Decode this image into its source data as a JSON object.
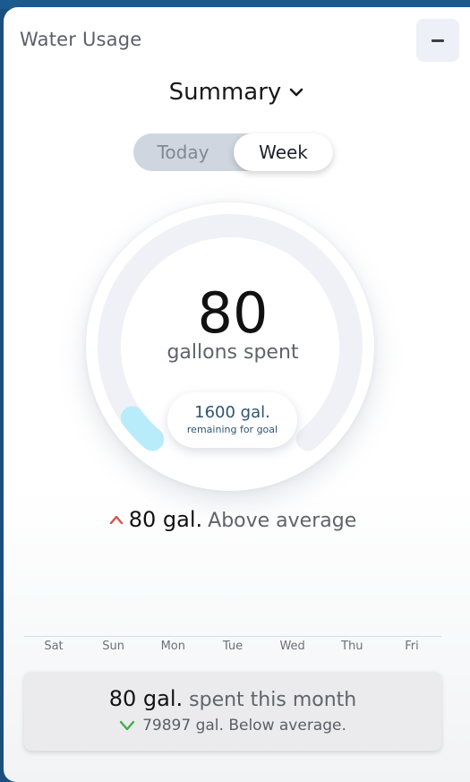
{
  "header": {
    "title": "Water Usage"
  },
  "summary": {
    "label": "Summary"
  },
  "period_toggle": {
    "options": [
      "Today",
      "Week"
    ],
    "selected": "Week"
  },
  "gauge": {
    "value": "80",
    "label": "gallons spent",
    "remaining_value": "1600 gal.",
    "remaining_caption": "remaining for goal",
    "progress_fraction": 0.05,
    "track_color": "#eff1f6",
    "progress_color": "#b9ecfb"
  },
  "comparison": {
    "amount": "80 gal.",
    "text": "Above average",
    "arrow_color": "#d9534f"
  },
  "chart": {
    "days": [
      "Sat",
      "Sun",
      "Mon",
      "Tue",
      "Wed",
      "Thu",
      "Fri"
    ]
  },
  "month": {
    "amount": "80 gal.",
    "text": "spent this month",
    "sub_text": "79897 gal. Below average.",
    "check_color": "#3fae49"
  },
  "colors": {
    "frame": "#1a4f7e",
    "toggle_track": "#cfd6df"
  }
}
